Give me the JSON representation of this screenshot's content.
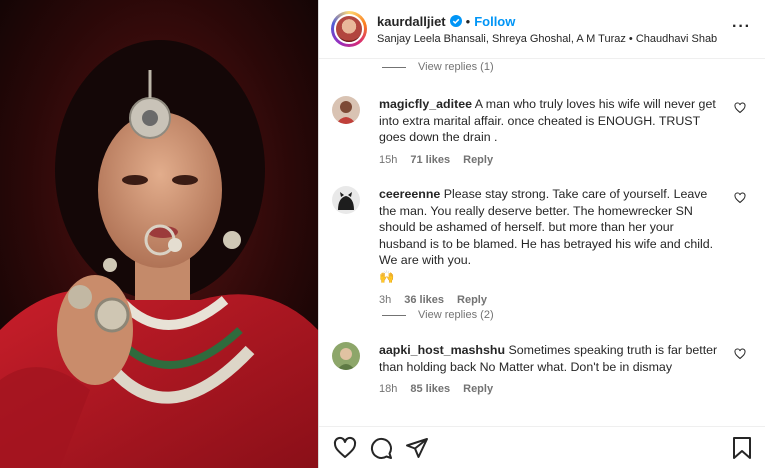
{
  "header": {
    "username": "kaurdalljiet",
    "follow_label": "Follow",
    "dot": "•",
    "subtitle": "Sanjay Leela Bhansali, Shreya Ghoshal, A M Turaz • Chaudhavi Shab",
    "more_label": "···"
  },
  "comments": {
    "view_replies_1": "View replies (1)",
    "view_replies_2": "View replies (2)",
    "items": [
      {
        "user": "magicfly_aditee",
        "text": "A man who truly loves his wife will never get into extra marital affair. once cheated is ENOUGH. TRUST goes down the drain .",
        "time": "15h",
        "likes": "71 likes",
        "reply": "Reply"
      },
      {
        "user": "ceereenne",
        "text": "Please stay strong. Take care of yourself. Leave the man. You really deserve better. The homewrecker SN should be ashamed of herself. but more than her your husband is to be blamed. He has betrayed his wife and child. We are with you.",
        "emoji": "🙌",
        "time": "3h",
        "likes": "36 likes",
        "reply": "Reply"
      },
      {
        "user": "aapki_host_mashshu",
        "text": "Sometimes speaking truth is far better than holding back No Matter what. Don't be in dismay",
        "time": "18h",
        "likes": "85 likes",
        "reply": "Reply"
      }
    ]
  },
  "colors": {
    "accent": "#0095f6",
    "muted": "#737373",
    "text": "#262626"
  },
  "icons": {
    "like": "heart-icon",
    "comment": "comment-icon",
    "share": "share-icon",
    "save": "bookmark-icon"
  }
}
